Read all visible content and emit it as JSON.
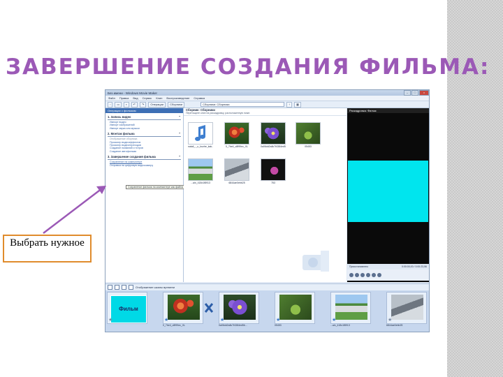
{
  "slide": {
    "title": "ЗАВЕРШЕНИЕ СОЗДАНИЯ ФИЛЬМА:",
    "callout": "Выбрать нужное",
    "colors": {
      "title": "#9b59b6",
      "callout_border": "#e08b2c",
      "arrow": "#9b59b6"
    }
  },
  "window": {
    "title": "Без имени - Windows Movie Maker",
    "menu": [
      "Файл",
      "Правка",
      "Вид",
      "Сервис",
      "Клип",
      "Воспроизведение",
      "Справка"
    ],
    "toolbar": {
      "tasks_label": "Операции",
      "collections_label": "Сборники",
      "collection_select": "Сборники: Сборники"
    },
    "tasks_panel": {
      "header": "Операции с фильмом",
      "sections": [
        {
          "title": "1. Запись видео",
          "links": [
            "Импорт видео",
            "Импорт изображений",
            "Импорт звука или музыки"
          ]
        },
        {
          "title": "2. Монтаж фильма",
          "links": [
            "Отображение сборника",
            "Просмотр видеоэффектов",
            "Просмотр видеопереходов",
            "Создание названий и титров",
            "Создание автофильма"
          ]
        },
        {
          "title": "3. Завершение создания фильма",
          "links": [
            "Сохранение на компьютере",
            "Отправка на цифровую видеокамеру"
          ]
        }
      ],
      "tooltip": "Сохранение фильма на компьютере как файла видео."
    },
    "collection": {
      "header": "Сборник: Сборники",
      "subheader": "Перетащите клип на раскадровку, расположенную ниже.",
      "items": [
        {
          "caption": "natali_-_u_bozhe_kak...",
          "pic": "p-music"
        },
        {
          "caption": "0_7be4_c8f99ec_XL",
          "pic": "p-flower"
        },
        {
          "caption": "0a06dd2a8c7f4384ed5b...",
          "pic": "p-purple"
        },
        {
          "caption": "05453",
          "pic": "p-leaf"
        },
        {
          "caption": "...ain_418x1f8913",
          "pic": "p-house"
        },
        {
          "caption": "6844ae0ebb25",
          "pic": "p-road"
        },
        {
          "caption": "753",
          "pic": "p-dark"
        }
      ]
    },
    "monitor": {
      "header": "Раскадровка: Фильм",
      "status": "Приостановлено",
      "time": "0:00:00,00 / 0:00:23,56"
    },
    "timeline": {
      "toggle_label": "Отображение шкалы времени",
      "clips": [
        {
          "caption": "Фильм",
          "pic": "film"
        },
        {
          "caption": "0_7be4_c8f99ec_XL",
          "pic": "p-flower"
        },
        {
          "caption": "0a06dd2a8c7f4384ed5b...",
          "pic": "p-purple"
        },
        {
          "caption": "05453",
          "pic": "p-leaf"
        },
        {
          "caption": "...ain_418x1f8913",
          "pic": "p-house"
        },
        {
          "caption": "6844ae0ebb25",
          "pic": "p-road"
        }
      ]
    }
  }
}
